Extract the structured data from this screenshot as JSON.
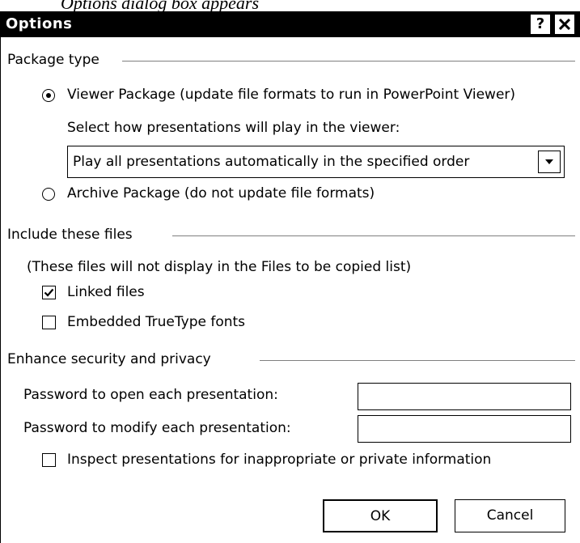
{
  "caption": "Options dialog box appears",
  "dialog": {
    "title": "Options",
    "help_label": "?",
    "close_label": "X"
  },
  "package_type": {
    "heading": "Package type",
    "viewer_label": "Viewer Package (update file formats to run in PowerPoint Viewer)",
    "viewer_selected": true,
    "select_prompt": "Select how presentations will play in the viewer:",
    "play_option": "Play all presentations automatically in the specified order",
    "archive_label": "Archive Package (do not update file formats)",
    "archive_selected": false
  },
  "include_files": {
    "heading": "Include these files",
    "note": "(These files will not display in the Files to be copied list)",
    "linked_label": "Linked files",
    "linked_checked": true,
    "embedded_label": "Embedded TrueType fonts",
    "embedded_checked": false
  },
  "security": {
    "heading": "Enhance security and privacy",
    "open_password_label": "Password to open each presentation:",
    "open_password_value": "",
    "modify_password_label": "Password to modify each presentation:",
    "modify_password_value": "",
    "inspect_label": "Inspect presentations for inappropriate or private information",
    "inspect_checked": false
  },
  "buttons": {
    "ok": "OK",
    "cancel": "Cancel"
  }
}
